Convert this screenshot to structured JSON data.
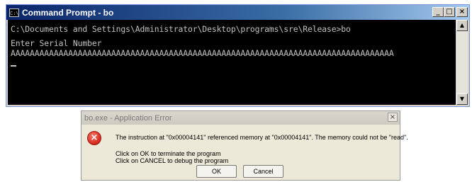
{
  "cmd_window": {
    "title": "Command Prompt - bo",
    "icon": "console-icon",
    "icon_glyph": "C:\\",
    "controls": {
      "minimize": "_",
      "maximize": "□",
      "close": "×"
    },
    "console_lines": [
      "C:\\Documents and Settings\\Administrator\\Desktop\\programs\\sre\\Release>bo",
      "Enter Serial Number",
      "AAAAAAAAAAAAAAAAAAAAAAAAAAAAAAAAAAAAAAAAAAAAAAAAAAAAAAAAAAAAAAAAAAAAAAAAAAAAAAAA"
    ],
    "scrollbar": {
      "up": "▲",
      "down": "▼"
    }
  },
  "error_dialog": {
    "title": "bo.exe - Application Error",
    "close_glyph": "×",
    "icon": "error-icon",
    "icon_glyph": "×",
    "message": "The instruction at \"0x00004141\" referenced memory at \"0x00004141\". The memory could not be \"read\".",
    "line_ok": "Click on OK to terminate the program",
    "line_cancel": "Click on CANCEL to debug the program",
    "ok_label": "OK",
    "cancel_label": "Cancel"
  }
}
